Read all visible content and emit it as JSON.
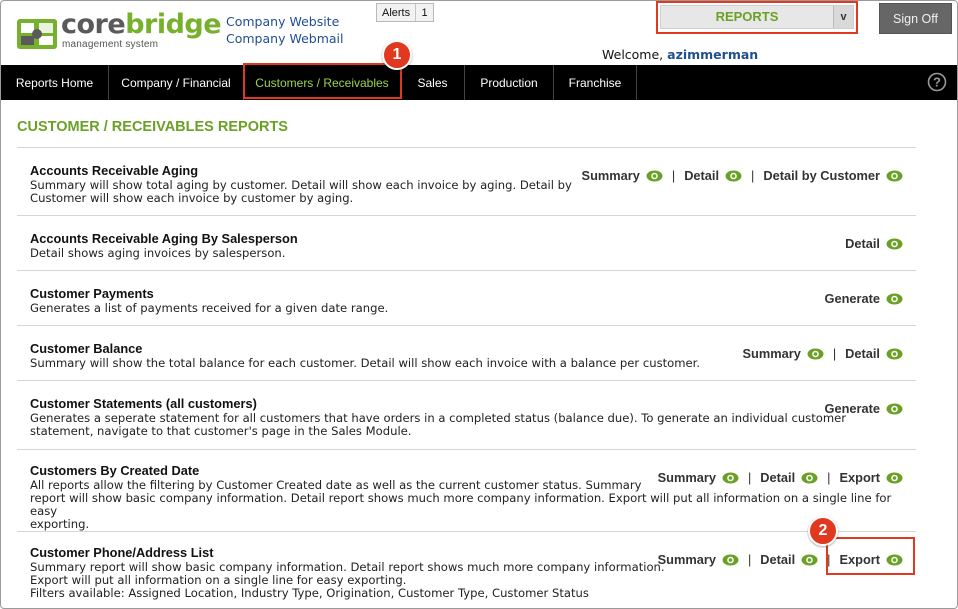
{
  "header": {
    "logo_part1": "core",
    "logo_part2": "bridge",
    "logo_sub": "management system",
    "links": [
      "Company Website",
      "Company Webmail"
    ],
    "alerts_label": "Alerts",
    "alerts_count": "1",
    "module_select": "REPORTS",
    "sign_off": "Sign Off",
    "welcome_prefix": "Welcome,",
    "username": "azimmerman"
  },
  "nav": {
    "items": [
      "Reports Home",
      "Company / Financial",
      "Customers / Receivables",
      "Sales",
      "Production",
      "Franchise"
    ],
    "active": "Customers / Receivables"
  },
  "callouts": [
    "1",
    "2"
  ],
  "page_title": "CUSTOMER / RECEIVABLES REPORTS",
  "reports": [
    {
      "title": "Accounts Receivable Aging",
      "desc": [
        "Summary will show total aging by customer. Detail will show each invoice by aging. Detail by",
        "Customer will show each invoice by customer by aging."
      ],
      "actions": [
        "Summary",
        "Detail",
        "Detail by Customer"
      ]
    },
    {
      "title": "Accounts Receivable Aging By Salesperson",
      "desc": [
        "Detail shows aging invoices by salesperson."
      ],
      "actions": [
        "Detail"
      ]
    },
    {
      "title": "Customer Payments",
      "desc": [
        "Generates a list of payments received for a given date range."
      ],
      "actions": [
        "Generate"
      ]
    },
    {
      "title": "Customer Balance",
      "desc": [
        "Summary will show the total balance for each customer. Detail will show each invoice with a balance per customer."
      ],
      "actions": [
        "Summary",
        "Detail"
      ]
    },
    {
      "title": "Customer Statements (all customers)",
      "desc": [
        "Generates a seperate statement for all customers that have orders in a completed status (balance due). To generate an individual customer",
        "statement, navigate to that customer's page in the Sales Module."
      ],
      "actions": [
        "Generate"
      ]
    },
    {
      "title": "Customers By Created Date",
      "desc": [
        "All reports allow the filtering by Customer Created date as well as the current customer status. Summary",
        "report will show basic company information. Detail report shows much more company information. Export will put all information on a single line for easy",
        "exporting."
      ],
      "actions": [
        "Summary",
        "Detail",
        "Export"
      ]
    },
    {
      "title": "Customer Phone/Address List",
      "desc": [
        "Summary report will show basic company information. Detail report shows much more company information.",
        "Export will put all information on a single line for easy exporting.",
        "Filters available: Assigned Location, Industry Type, Origination, Customer Type, Customer Status"
      ],
      "actions": [
        "Summary",
        "Detail",
        "Export"
      ]
    }
  ],
  "colors": {
    "accent_green": "#6aa125",
    "nav_active": "#9ad44a",
    "callout_red": "#e0391f",
    "link_blue": "#1f4f8f",
    "eye_icon": "#6aa125"
  },
  "icons": {
    "action": "eye-icon",
    "help": "help-icon"
  }
}
